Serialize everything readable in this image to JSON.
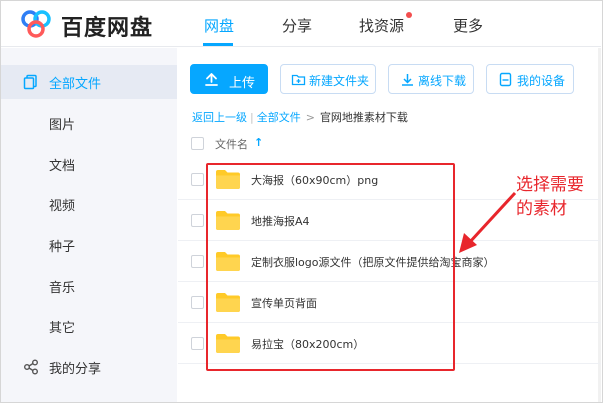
{
  "header": {
    "brand": "百度网盘",
    "nav": [
      {
        "label": "网盘",
        "active": true
      },
      {
        "label": "分享",
        "active": false
      },
      {
        "label": "找资源",
        "active": false,
        "badge": "red-dot"
      },
      {
        "label": "更多",
        "active": false
      }
    ]
  },
  "sidebar": {
    "items": [
      {
        "label": "全部文件",
        "active": true,
        "icon": "files-icon"
      },
      {
        "label": "图片"
      },
      {
        "label": "文档"
      },
      {
        "label": "视频"
      },
      {
        "label": "种子"
      },
      {
        "label": "音乐"
      },
      {
        "label": "其它"
      },
      {
        "label": "我的分享",
        "icon": "share-icon"
      }
    ]
  },
  "toolbar": {
    "upload": "上传",
    "new_folder": "新建文件夹",
    "offline_download": "离线下载",
    "my_devices": "我的设备"
  },
  "breadcrumb": {
    "back": "返回上一级",
    "all_files": "全部文件",
    "current": "官网地推素材下载"
  },
  "file_list": {
    "column_name": "文件名",
    "sort_icon": "arrow-up-icon",
    "rows": [
      {
        "name": "大海报（60x90cm）png",
        "type": "folder"
      },
      {
        "name": "地推海报A4",
        "type": "folder"
      },
      {
        "name": "定制衣服logo源文件（把原文件提供给淘宝商家）",
        "type": "folder"
      },
      {
        "name": "宣传单页背面",
        "type": "folder"
      },
      {
        "name": "易拉宝（80x200cm）",
        "type": "folder"
      }
    ]
  },
  "annotation": {
    "text": "选择需要的素材",
    "color": "#e8262c"
  },
  "colors": {
    "accent": "#06a7ff",
    "folder": "#ffca28",
    "sidebar_bg": "#f5f6fa"
  }
}
